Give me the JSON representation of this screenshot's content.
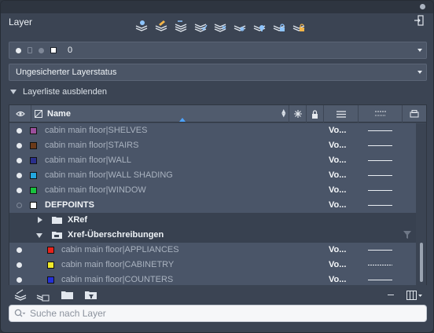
{
  "panel": {
    "title": "Layer"
  },
  "current_layer": {
    "name": "0",
    "color": "#ffffff"
  },
  "layer_state": {
    "value": "Ungesicherter Layerstatus"
  },
  "layer_list_toggle": {
    "label": "Layerliste ausblenden"
  },
  "table": {
    "header": {
      "name": "Name"
    },
    "rows": [
      {
        "name": "cabin main floor|SHELVES",
        "color": "#9b4f9c",
        "visible": true,
        "viewport": "Vo...",
        "linetype": "solid",
        "xref": true
      },
      {
        "name": "cabin main floor|STAIRS",
        "color": "#6b3a1a",
        "visible": true,
        "viewport": "Vo...",
        "linetype": "solid",
        "xref": true
      },
      {
        "name": "cabin main floor|WALL",
        "color": "#2a2f8c",
        "visible": true,
        "viewport": "Vo...",
        "linetype": "solid",
        "xref": true
      },
      {
        "name": "cabin main floor|WALL SHADING",
        "color": "#22a6df",
        "visible": true,
        "viewport": "Vo...",
        "linetype": "solid",
        "xref": true
      },
      {
        "name": "cabin main floor|WINDOW",
        "color": "#19c23f",
        "visible": true,
        "viewport": "Vo...",
        "linetype": "solid",
        "xref": true
      },
      {
        "name": "DEFPOINTS",
        "color": "#ffffff",
        "visible": false,
        "viewport": "Vo...",
        "linetype": "solid",
        "xref": false
      }
    ],
    "groups": [
      {
        "label": "XRef",
        "expanded": false
      },
      {
        "label": "Xref-Überschreibungen",
        "expanded": true
      }
    ],
    "override_rows": [
      {
        "name": "cabin main floor|APPLIANCES",
        "color": "#e8221a",
        "visible": true,
        "viewport": "Vo...",
        "linetype": "solid"
      },
      {
        "name": "cabin main floor|CABINETRY",
        "color": "#f1ea2a",
        "visible": true,
        "viewport": "Vo...",
        "linetype": "dashed"
      },
      {
        "name": "cabin main floor|COUNTERS",
        "color": "#2430d6",
        "visible": true,
        "viewport": "Vo...",
        "linetype": "solid"
      }
    ]
  },
  "search": {
    "placeholder": "Suche nach Layer"
  },
  "icons": {
    "toolbar": [
      "layer-properties-icon",
      "layer-match-icon",
      "layer-previous-icon",
      "layer-isolate-icon",
      "layer-unisolate-icon",
      "layer-freeze-icon",
      "layer-off-icon",
      "layer-lock-icon",
      "layer-unlock-icon"
    ],
    "bottom": [
      "new-layer-icon",
      "new-layer-vp-frozen-icon",
      "new-group-filter-icon",
      "new-property-filter-icon"
    ]
  }
}
